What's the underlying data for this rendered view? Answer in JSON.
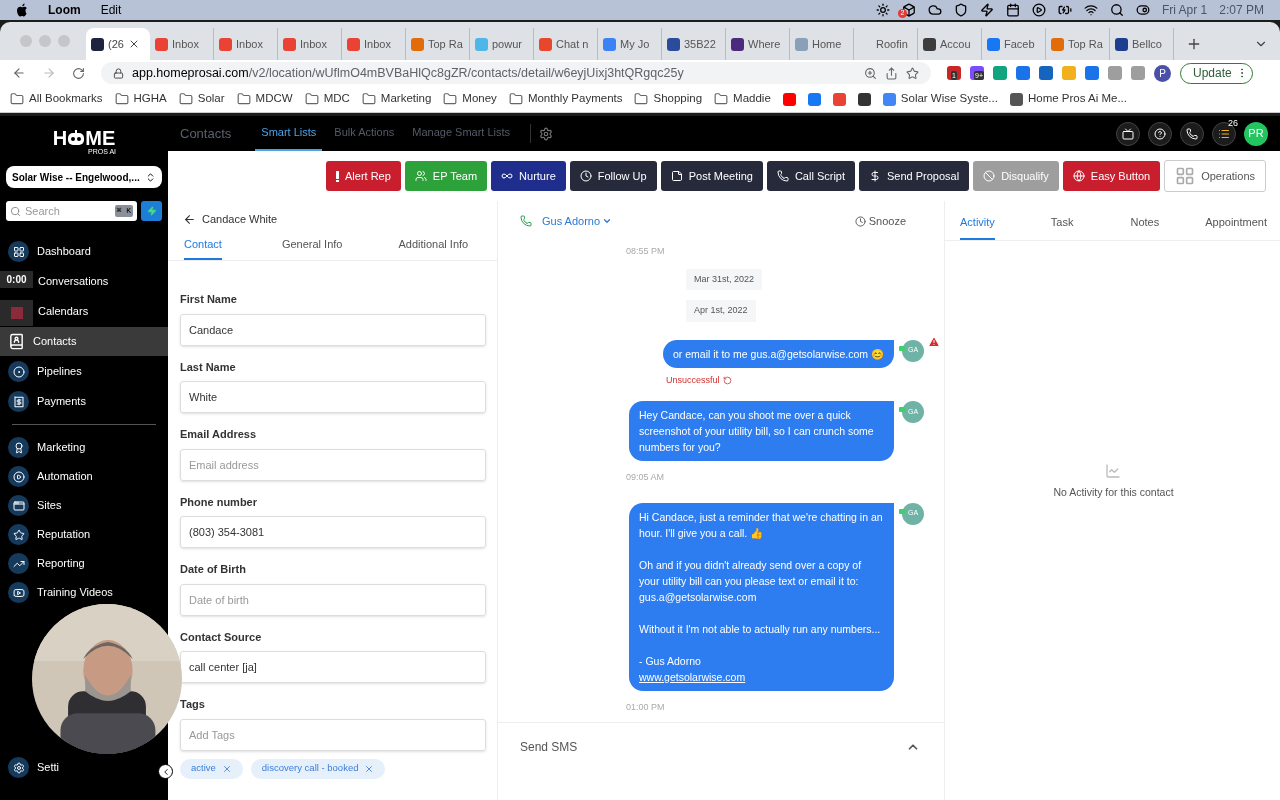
{
  "menubar": {
    "app": "Loom",
    "menus": [
      "Edit"
    ],
    "dropbox_badge": "2",
    "date": "Fri Apr 1",
    "time": "2:07 PM"
  },
  "browser": {
    "tabs": [
      {
        "label": "(26",
        "selected": true,
        "color": "#1f2340"
      },
      {
        "label": "Inbox",
        "selected": false,
        "color": "#ea4335"
      },
      {
        "label": "Inbox",
        "selected": false,
        "color": "#ea4335"
      },
      {
        "label": "Inbox",
        "selected": false,
        "color": "#ea4335"
      },
      {
        "label": "Inbox",
        "selected": false,
        "color": "#ea4335"
      },
      {
        "label": "Top Ra",
        "selected": false,
        "color": "#e36c0a"
      },
      {
        "label": "powur",
        "selected": false,
        "color": "#4fb6e8"
      },
      {
        "label": "Chat n",
        "selected": false,
        "color": "#e8462d"
      },
      {
        "label": "My Jo",
        "selected": false,
        "color": "#3b82f6"
      },
      {
        "label": "35B22",
        "selected": false,
        "color": "#2b4c9b"
      },
      {
        "label": "Where",
        "selected": false,
        "color": "#4b2a7d"
      },
      {
        "label": "Home",
        "selected": false,
        "color": "#8aa0b8"
      },
      {
        "label": "Roofin",
        "selected": false
      },
      {
        "label": "Accou",
        "selected": false,
        "color": "#3c3c3c"
      },
      {
        "label": "Faceb",
        "selected": false,
        "color": "#1877f2"
      },
      {
        "label": "Top Ra",
        "selected": false,
        "color": "#e36c0a"
      },
      {
        "label": "Bellco",
        "selected": false,
        "color": "#1d3d8f"
      }
    ],
    "url_host": "app.homeprosai.com",
    "url_path": "/v2/location/wUflmO4mBVBaHlQc8gZR/contacts/detail/w6eyjUixj3htQRgqc25y",
    "extensions": [
      {
        "color": "#c62828",
        "badge": "1"
      },
      {
        "color": "#7c4dff",
        "badge": "9+"
      },
      {
        "color": "#12a37f"
      },
      {
        "color": "#1a73e8"
      },
      {
        "color": "#1565c0"
      },
      {
        "color": "#f2b01e"
      },
      {
        "color": "#1a73e8"
      },
      {
        "color": "#9e9e9e"
      },
      {
        "color": "#9e9e9e"
      }
    ],
    "profile": "P",
    "update": "Update",
    "bookmarks": [
      {
        "kind": "folder",
        "label": "All Bookmarks"
      },
      {
        "kind": "folder",
        "label": "HGHA"
      },
      {
        "kind": "folder",
        "label": "Solar"
      },
      {
        "kind": "folder",
        "label": "MDCW"
      },
      {
        "kind": "folder",
        "label": "MDC"
      },
      {
        "kind": "folder",
        "label": "Marketing"
      },
      {
        "kind": "folder",
        "label": "Money"
      },
      {
        "kind": "folder",
        "label": "Monthly Payments"
      },
      {
        "kind": "folder",
        "label": "Shopping"
      },
      {
        "kind": "folder",
        "label": "Maddie"
      },
      {
        "kind": "site",
        "color": "#ff0000"
      },
      {
        "kind": "site",
        "color": "#1877f2"
      },
      {
        "kind": "site",
        "color": "#ea4335"
      },
      {
        "kind": "site",
        "color": "#333333"
      },
      {
        "kind": "site",
        "label": "Solar Wise Syste...",
        "color": "#4285f4"
      },
      {
        "kind": "site",
        "label": "Home Pros Ai Me...",
        "color": "#555555"
      }
    ]
  },
  "sidebar": {
    "logo": {
      "left": "H",
      "right": "ME",
      "tagline": "PROS AI"
    },
    "location": "Solar Wise -- Engelwood,...",
    "search": {
      "placeholder": "Search",
      "shortcut": "⌘ K"
    },
    "items": [
      {
        "label": "Dashboard",
        "selected": false
      },
      {
        "label": "Conversations",
        "selected": false
      },
      {
        "label": "Calendars",
        "selected": false
      },
      {
        "label": "Contacts",
        "selected": true
      },
      {
        "label": "Pipelines",
        "selected": false
      },
      {
        "label": "Payments",
        "selected": false
      },
      {
        "label": "Marketing",
        "selected": false
      },
      {
        "label": "Automation",
        "selected": false
      },
      {
        "label": "Sites",
        "selected": false
      },
      {
        "label": "Reputation",
        "selected": false
      },
      {
        "label": "Reporting",
        "selected": false
      },
      {
        "label": "Training Videos",
        "selected": false
      }
    ],
    "settings": "Setti"
  },
  "loom": {
    "timer": "0:00"
  },
  "topnav": {
    "title": "Contacts",
    "tabs": [
      {
        "label": "Smart Lists",
        "selected": true
      },
      {
        "label": "Bulk Actions",
        "selected": false
      },
      {
        "label": "Manage Smart Lists",
        "selected": false
      }
    ],
    "badge": "26",
    "avatar": "PR"
  },
  "actions": [
    {
      "label": "Alert Rep",
      "color": "#c81e2d"
    },
    {
      "label": "EP Team",
      "color": "#2ea23a"
    },
    {
      "label": "Nurture",
      "color": "#1f2d8c"
    },
    {
      "label": "Follow Up",
      "color": "#262a3b"
    },
    {
      "label": "Post Meeting",
      "color": "#262a3b"
    },
    {
      "label": "Call Script",
      "color": "#262a3b"
    },
    {
      "label": "Send Proposal",
      "color": "#262a3b"
    },
    {
      "label": "Disqualify",
      "color": "#9e9e9e"
    },
    {
      "label": "Easy Button",
      "color": "#c81e2d"
    },
    {
      "label": "Operations",
      "color": "#ffffff"
    }
  ],
  "contact": {
    "name": "Candace White",
    "tabs": [
      {
        "label": "Contact",
        "selected": true
      },
      {
        "label": "General Info",
        "selected": false
      },
      {
        "label": "Additional Info",
        "selected": false
      }
    ],
    "fields": [
      {
        "label": "First Name",
        "value": "Candace"
      },
      {
        "label": "Last Name",
        "value": "White"
      },
      {
        "label": "Email Address",
        "placeholder": "Email address"
      },
      {
        "label": "Phone number",
        "value": "(803) 354-3081"
      },
      {
        "label": "Date of Birth",
        "placeholder": "Date of birth"
      },
      {
        "label": "Contact Source",
        "value": "call center [ja]"
      },
      {
        "label": "Tags",
        "placeholder": "Add Tags"
      }
    ],
    "tags": [
      "active",
      "discovery call - booked"
    ]
  },
  "conversation": {
    "agent": "Gus Adorno",
    "snooze": "Snooze",
    "thread": [
      {
        "kind": "time",
        "text": "08:55 PM"
      },
      {
        "kind": "date",
        "text": "Mar 31st, 2022"
      },
      {
        "kind": "date",
        "text": "Apr 1st, 2022"
      },
      {
        "kind": "message",
        "avatar": "GA",
        "failed": true,
        "status": "Unsuccessful",
        "paragraphs": [
          "or email it to me gus.a@getsolarwise.com 😊"
        ]
      },
      {
        "kind": "message",
        "avatar": "GA",
        "failed": false,
        "paragraphs": [
          "Hey Candace, can you shoot me over a quick screenshot of your utility bill, so I can crunch some numbers for you?"
        ]
      },
      {
        "kind": "time",
        "text": "09:05 AM"
      },
      {
        "kind": "message",
        "avatar": "GA",
        "failed": false,
        "paragraphs": [
          "Hi Candace, just a reminder that we're chatting in an hour. I'll give you a call. 👍",
          "Oh and if you didn't already send over a copy of your utility bill can you please text or email it to: gus.a@getsolarwise.com",
          "Without it I'm not able to actually run any numbers...",
          "- Gus Adorno"
        ],
        "link": "www.getsolarwise.com"
      },
      {
        "kind": "time",
        "text": "01:00 PM"
      }
    ],
    "composer": "Send SMS"
  },
  "activity": {
    "tabs": [
      {
        "label": "Activity",
        "selected": true
      },
      {
        "label": "Task",
        "selected": false
      },
      {
        "label": "Notes",
        "selected": false
      },
      {
        "label": "Appointment",
        "selected": false
      }
    ],
    "empty": "No Activity for this contact"
  }
}
